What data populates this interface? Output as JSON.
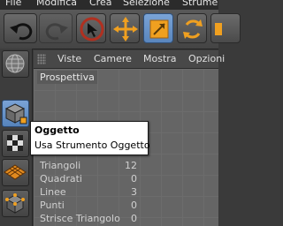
{
  "menubar": {
    "items": [
      "File",
      "Modifica",
      "Crea",
      "Selezione",
      "Strumenti"
    ]
  },
  "toolbar": {
    "buttons": [
      {
        "icon": "undo-icon"
      },
      {
        "icon": "redo-icon"
      },
      {
        "icon": "select-arrow-icon"
      },
      {
        "icon": "move-icon"
      },
      {
        "icon": "scale-icon"
      },
      {
        "icon": "rotate-icon"
      },
      {
        "icon": "more-icon"
      }
    ]
  },
  "viewport": {
    "menu": [
      "Viste",
      "Camere",
      "Mostra",
      "Opzioni"
    ],
    "label": "Prospettiva"
  },
  "tooltip": {
    "title": "Oggetto",
    "description": "Usa Strumento Oggetto"
  },
  "stats": [
    {
      "label": "Triangoli",
      "value": "12"
    },
    {
      "label": "Quadrati",
      "value": "0"
    },
    {
      "label": "Linee",
      "value": "3"
    },
    {
      "label": "Punti",
      "value": "0"
    },
    {
      "label": "Strisce Triangolo",
      "value": "0"
    }
  ],
  "colors": {
    "accent": "#6f9ad0",
    "highlight": "#f0a020",
    "background": "#3a3a3a"
  }
}
